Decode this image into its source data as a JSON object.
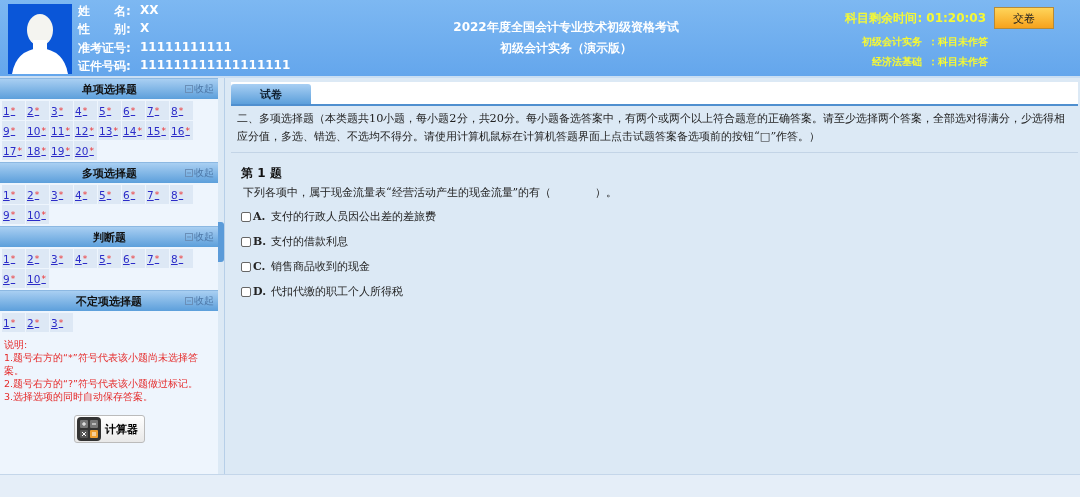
{
  "header": {
    "candidate": [
      {
        "label": "姓　　名:",
        "value": "XX"
      },
      {
        "label": "性　　别:",
        "value": "X"
      },
      {
        "label": "准考证号:",
        "value": "11111111111"
      },
      {
        "label": "证件号码:",
        "value": "111111111111111111"
      }
    ],
    "exam_title": "2022年度全国会计专业技术初级资格考试",
    "exam_subtitle": "初级会计实务（演示版）",
    "timer_label": "科目剩余时间:",
    "timer_value": "01:20:03",
    "submit_button": "交卷",
    "subjects": [
      {
        "name": "初级会计实务",
        "status": "：科目未作答"
      },
      {
        "name": "经济法基础",
        "status": "：科目未作答"
      }
    ]
  },
  "sidebar": {
    "sections": [
      {
        "title": "单项选择题",
        "collapse": "收起",
        "items": [
          {
            "number": "1",
            "mark": "*"
          },
          {
            "number": "2",
            "mark": "*"
          },
          {
            "number": "3",
            "mark": "*"
          },
          {
            "number": "4",
            "mark": "*"
          },
          {
            "number": "5",
            "mark": "*"
          },
          {
            "number": "6",
            "mark": "*"
          },
          {
            "number": "7",
            "mark": "*"
          },
          {
            "number": "8",
            "mark": "*"
          },
          {
            "number": "9",
            "mark": "*"
          },
          {
            "number": "10",
            "mark": "*"
          },
          {
            "number": "11",
            "mark": "*"
          },
          {
            "number": "12",
            "mark": "*"
          },
          {
            "number": "13",
            "mark": "*"
          },
          {
            "number": "14",
            "mark": "*"
          },
          {
            "number": "15",
            "mark": "*"
          },
          {
            "number": "16",
            "mark": "*"
          },
          {
            "number": "17",
            "mark": "*"
          },
          {
            "number": "18",
            "mark": "*"
          },
          {
            "number": "19",
            "mark": "*"
          },
          {
            "number": "20",
            "mark": "*"
          }
        ]
      },
      {
        "title": "多项选择题",
        "collapse": "收起",
        "items": [
          {
            "number": "1",
            "mark": "*"
          },
          {
            "number": "2",
            "mark": "*"
          },
          {
            "number": "3",
            "mark": "*"
          },
          {
            "number": "4",
            "mark": "*"
          },
          {
            "number": "5",
            "mark": "*"
          },
          {
            "number": "6",
            "mark": "*"
          },
          {
            "number": "7",
            "mark": "*"
          },
          {
            "number": "8",
            "mark": "*"
          },
          {
            "number": "9",
            "mark": "*"
          },
          {
            "number": "10",
            "mark": "*"
          }
        ]
      },
      {
        "title": "判断题",
        "collapse": "收起",
        "items": [
          {
            "number": "1",
            "mark": "*"
          },
          {
            "number": "2",
            "mark": "*"
          },
          {
            "number": "3",
            "mark": "*"
          },
          {
            "number": "4",
            "mark": "*"
          },
          {
            "number": "5",
            "mark": "*"
          },
          {
            "number": "6",
            "mark": "*"
          },
          {
            "number": "7",
            "mark": "*"
          },
          {
            "number": "8",
            "mark": "*"
          },
          {
            "number": "9",
            "mark": "*"
          },
          {
            "number": "10",
            "mark": "*"
          }
        ]
      },
      {
        "title": "不定项选择题",
        "collapse": "收起",
        "items": [
          {
            "number": "1",
            "mark": "*"
          },
          {
            "number": "2",
            "mark": "*"
          },
          {
            "number": "3",
            "mark": "*"
          }
        ]
      }
    ],
    "notes": [
      "说明:",
      "1.题号右方的“*”符号代表该小题尚未选择答案。",
      "2.题号右方的“?”符号代表该小题做过标记。",
      "3.选择选项的同时自动保存答案。"
    ],
    "calculator_button": "计算器"
  },
  "main": {
    "tabs": [
      {
        "label": "试卷",
        "selected": true
      }
    ],
    "instructions": "二、多项选择题（本类题共10小题，每小题2分，共20分。每小题备选答案中，有两个或两个以上符合题意的正确答案。请至少选择两个答案，全部选对得满分，少选得相应分值，多选、错选、不选均不得分。请使用计算机鼠标在计算机答题界面上点击试题答案备选项前的按钮“□”作答。）",
    "question": {
      "title": "第 1 题",
      "stem": "下列各项中，属于现金流量表“经营活动产生的现金流量”的有（　　　　）。",
      "options": [
        {
          "label": "A.",
          "text": "支付的行政人员因公出差的差旅费",
          "checked": false
        },
        {
          "label": "B.",
          "text": "支付的借款利息",
          "checked": false
        },
        {
          "label": "C.",
          "text": "销售商品收到的现金",
          "checked": false
        },
        {
          "label": "D.",
          "text": "代扣代缴的职工个人所得税",
          "checked": false
        }
      ]
    }
  }
}
